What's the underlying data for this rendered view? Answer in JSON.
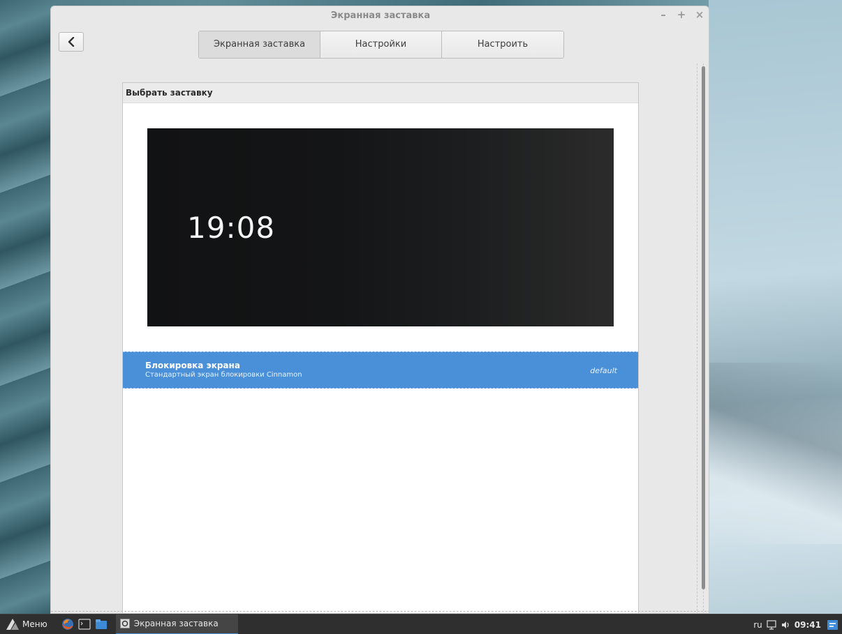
{
  "window": {
    "title": "Экранная заставка",
    "controls": {
      "minimize": "–",
      "maximize": "+",
      "close": "×"
    }
  },
  "tabs": [
    {
      "label": "Экранная заставка",
      "active": true
    },
    {
      "label": "Настройки",
      "active": false
    },
    {
      "label": "Настроить",
      "active": false
    }
  ],
  "panel": {
    "header": "Выбрать заставку",
    "preview_time": "19:08",
    "items": [
      {
        "title": "Блокировка экрана",
        "description": "Стандартный экран блокировки Cinnamon",
        "tag": "default",
        "selected": true
      }
    ]
  },
  "taskbar": {
    "menu_label": "Меню",
    "launchers": [
      "firefox-icon",
      "terminal-icon",
      "files-icon"
    ],
    "task_label": "Экранная заставка",
    "keyboard_layout": "ru",
    "clock": "09:41"
  },
  "colors": {
    "selection": "#4a90d9",
    "taskbar": "#2f2f2f",
    "window_bg": "#e8e8e8"
  }
}
